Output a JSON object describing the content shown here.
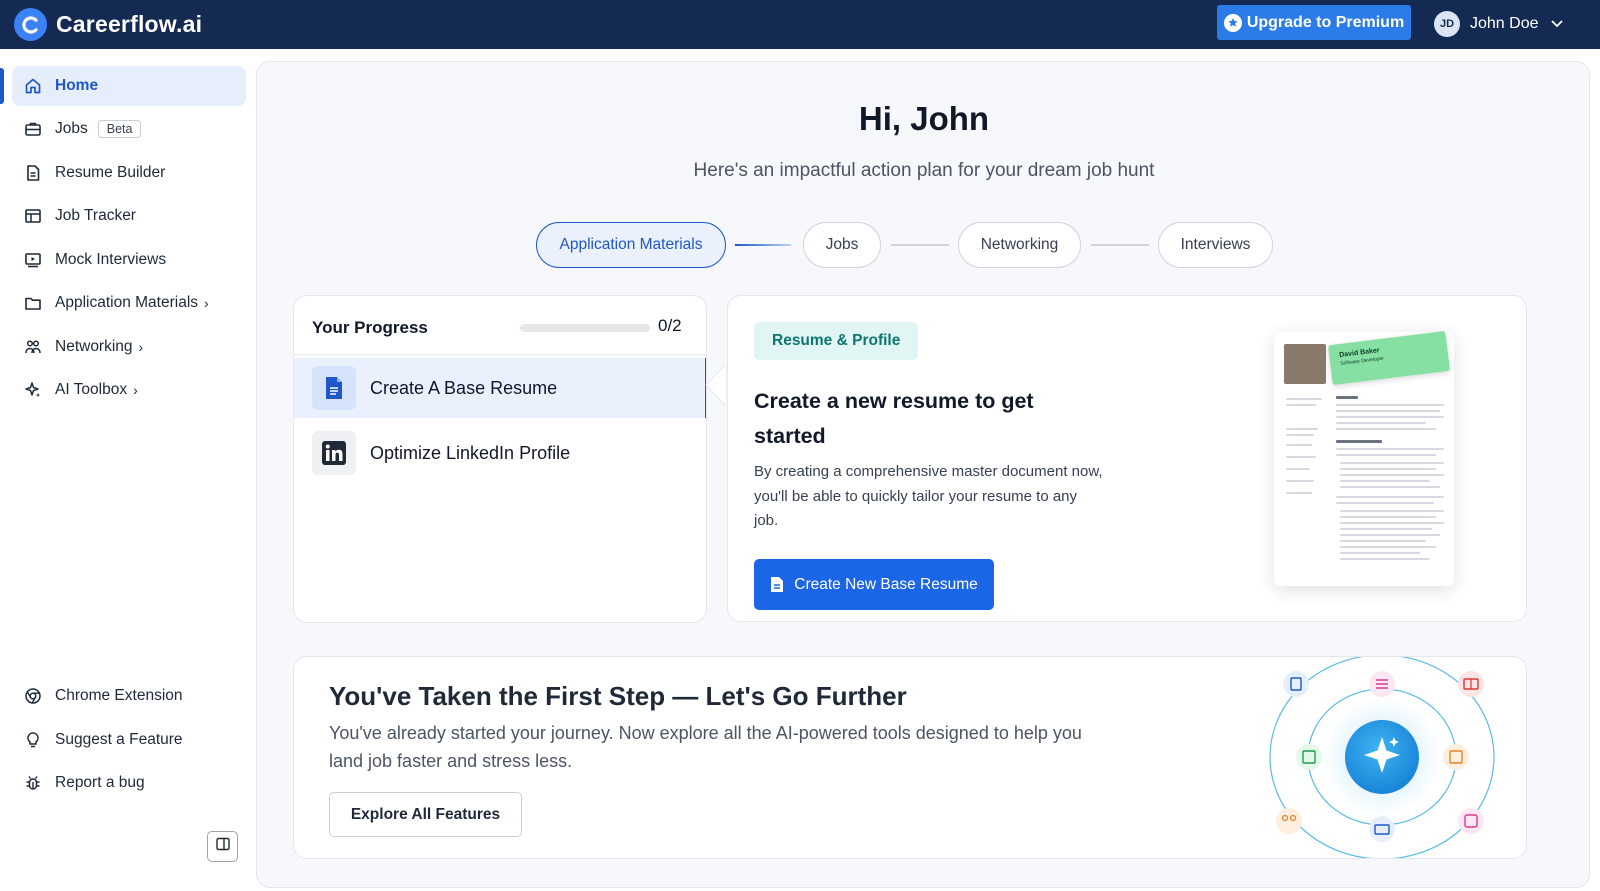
{
  "header": {
    "brand": "Careerflow.ai",
    "upgrade_label": "Upgrade to Premium",
    "user_initials": "JD",
    "user_name": "John Doe"
  },
  "sidebar": {
    "items": [
      {
        "label": "Home",
        "icon": "home-icon",
        "active": true
      },
      {
        "label": "Jobs",
        "icon": "briefcase-icon",
        "badge": "Beta"
      },
      {
        "label": "Resume Builder",
        "icon": "document-icon"
      },
      {
        "label": "Job Tracker",
        "icon": "table-icon"
      },
      {
        "label": "Mock Interviews",
        "icon": "video-icon"
      },
      {
        "label": "Application Materials",
        "icon": "folder-icon",
        "has_submenu": true
      },
      {
        "label": "Networking",
        "icon": "people-icon",
        "has_submenu": true
      },
      {
        "label": "AI Toolbox",
        "icon": "sparkle-icon",
        "has_submenu": true
      }
    ],
    "bottom_items": [
      {
        "label": "Chrome Extension",
        "icon": "chrome-icon"
      },
      {
        "label": "Suggest a Feature",
        "icon": "lightbulb-icon"
      },
      {
        "label": "Report a bug",
        "icon": "bug-icon"
      }
    ],
    "submenu_arrow": "›"
  },
  "main": {
    "greeting": "Hi, John",
    "subtitle": "Here's an impactful action plan for your dream job hunt",
    "steps": [
      {
        "label": "Application Materials",
        "active": true
      },
      {
        "label": "Jobs"
      },
      {
        "label": "Networking"
      },
      {
        "label": "Interviews"
      }
    ],
    "progress": {
      "title": "Your Progress",
      "completed": 0,
      "total": 2,
      "count_text": "0/2",
      "tasks": [
        {
          "label": "Create A Base Resume",
          "icon": "document-icon",
          "active": true
        },
        {
          "label": "Optimize LinkedIn Profile",
          "icon": "linkedin-icon"
        }
      ]
    },
    "resume_card": {
      "tag": "Resume & Profile",
      "title": "Create a new resume to get started",
      "description": "By creating a comprehensive master document now, you'll be able to quickly tailor your resume to any job.",
      "button_label": "Create New Base Resume",
      "preview_name": "David Baker",
      "preview_role": "Software Developer"
    },
    "further_card": {
      "title": "You've Taken the First Step — Let's Go Further",
      "description": "You've already started your journey. Now explore all the AI-powered tools designed to help you land job faster and stress less.",
      "button_label": "Explore All Features"
    }
  },
  "colors": {
    "topbar": "#142a52",
    "primary": "#1f57c9",
    "button_blue": "#1a66e6",
    "tag_bg": "#e1f6f4",
    "tag_text": "#0f766e"
  }
}
